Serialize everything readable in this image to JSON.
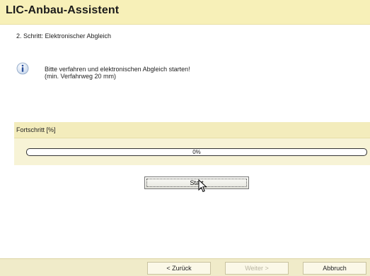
{
  "window": {
    "title": "LIC-Anbau-Assistent"
  },
  "step": {
    "label": "2. Schritt: Elektronischer Abgleich"
  },
  "message": {
    "icon": "info-icon",
    "line1": "Bitte verfahren und elektronischen Abgleich starten!",
    "line2": "(min. Verfahrweg 20 mm)"
  },
  "progress": {
    "header": "Fortschritt [%]",
    "value": 0,
    "text": "0%"
  },
  "actions": {
    "start_label": "Start"
  },
  "footer": {
    "back_label": "< Zurück",
    "next_label": "Weiter >",
    "next_enabled": false,
    "cancel_label": "Abbruch"
  },
  "colors": {
    "title_bg": "#f7f0b8",
    "panel_bg": "#f7f3d6",
    "footer_bg": "#f0ebc9"
  }
}
